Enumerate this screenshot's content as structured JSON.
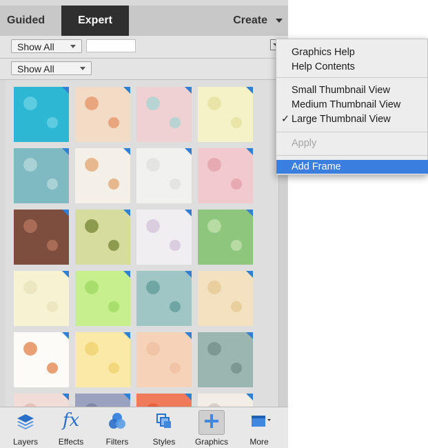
{
  "tabs": {
    "guided": "Guided",
    "expert": "Expert"
  },
  "create": {
    "label": "Create"
  },
  "filters": {
    "filter1": "Show All",
    "filter2": "Show All",
    "search_value": ""
  },
  "context_menu": {
    "graphics_help": "Graphics Help",
    "help_contents": "Help Contents",
    "small_view": "Small Thumbnail View",
    "medium_view": "Medium Thumbnail View",
    "large_view": "Large Thumbnail View",
    "checkmark": "✓",
    "apply": "Apply",
    "add_frame": "Add Frame"
  },
  "bottom_bar": {
    "layers": "Layers",
    "effects": "Effects",
    "fx_glyph": "fx",
    "filters": "Filters",
    "styles": "Styles",
    "graphics": "Graphics",
    "more": "More"
  },
  "colors": {
    "accent": "#3a7ee0",
    "expert_tab_bg": "#2f2f2f",
    "thumb_badge": "#2f7fd6"
  },
  "thumbnails": [
    {
      "c1": "#2db7d3",
      "c2": "#5dcbe0"
    },
    {
      "c1": "#f3dcc6",
      "c2": "#e9a57e"
    },
    {
      "c1": "#efd0d3",
      "c2": "#b8d4d2"
    },
    {
      "c1": "#f6f2c8",
      "c2": "#e8e5a6"
    },
    {
      "c1": "#7fb9c2",
      "c2": "#a9d2d6"
    },
    {
      "c1": "#f4efe7",
      "c2": "#e7b88e"
    },
    {
      "c1": "#f1f1f0",
      "c2": "#e4e4e2"
    },
    {
      "c1": "#f1c9cf",
      "c2": "#e7a9b2"
    },
    {
      "c1": "#7d4d3d",
      "c2": "#a96d57"
    },
    {
      "c1": "#d6dc9d",
      "c2": "#8d9b4e"
    },
    {
      "c1": "#f1eef2",
      "c2": "#dbcde0"
    },
    {
      "c1": "#8fc67e",
      "c2": "#b6dca4"
    },
    {
      "c1": "#f6f2d2",
      "c2": "#ece7c0"
    },
    {
      "c1": "#c8ef8e",
      "c2": "#a7de6c"
    },
    {
      "c1": "#9fc6c4",
      "c2": "#6fa6a4"
    },
    {
      "c1": "#f3e1bf",
      "c2": "#e9cf9e"
    },
    {
      "c1": "#fcfbf7",
      "c2": "#e8a074"
    },
    {
      "c1": "#fbeaa7",
      "c2": "#f3d77d"
    },
    {
      "c1": "#f6d3b8",
      "c2": "#f0c4a4"
    },
    {
      "c1": "#9bb5b0",
      "c2": "#7d9893"
    },
    {
      "c1": "#f1dcd7",
      "c2": "#e5c3bb"
    },
    {
      "c1": "#9aa2c0",
      "c2": "#7e87a6"
    },
    {
      "c1": "#f07b5a",
      "c2": "#e9603f"
    },
    {
      "c1": "#f3ede7",
      "c2": "#dcd1c8"
    }
  ]
}
